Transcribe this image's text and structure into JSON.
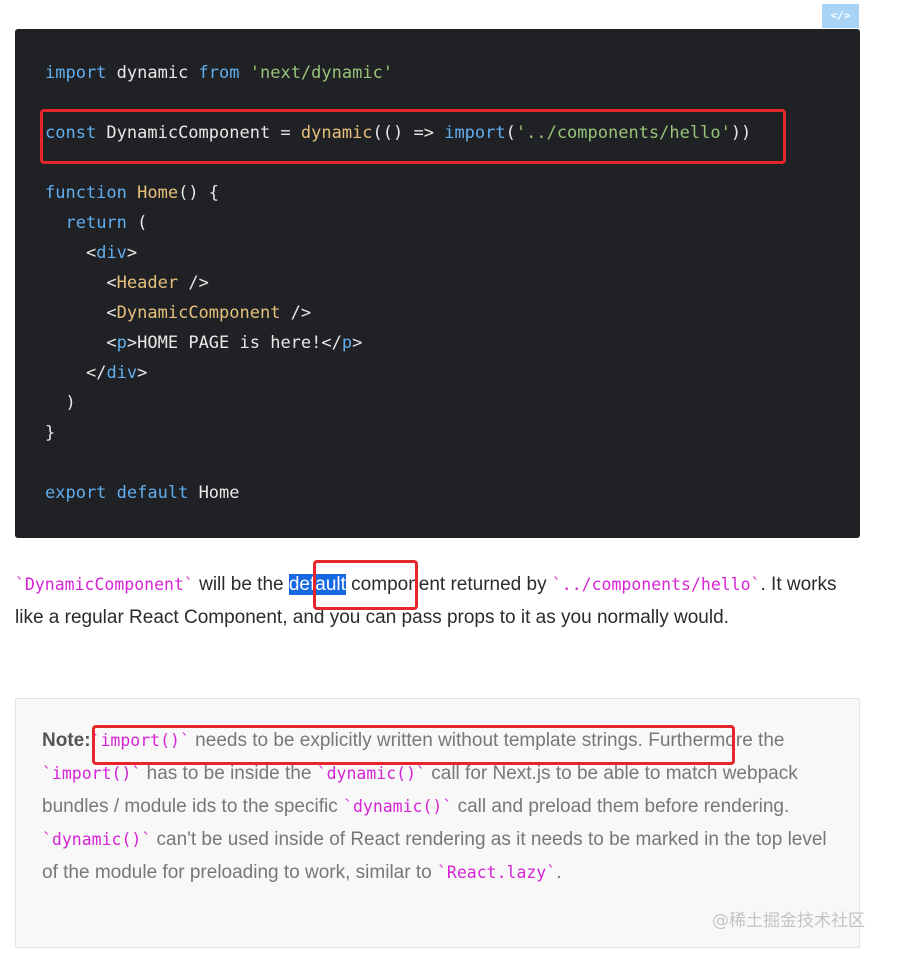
{
  "badge": {
    "label": "</>"
  },
  "code": {
    "line1": {
      "k1": "import",
      "t1": " dynamic ",
      "k2": "from",
      "sp": " ",
      "s1": "'next/dynamic'"
    },
    "line2": {
      "k1": "const",
      "t1": " DynamicComponent = ",
      "f1": "dynamic",
      "t2": "(() => ",
      "k2": "import",
      "t3": "(",
      "s1": "'../components/hello'",
      "t4": "))"
    },
    "line3": {
      "k1": "function",
      "sp": " ",
      "f1": "Home",
      "t1": "() {"
    },
    "line4": {
      "ind": "  ",
      "k1": "return",
      "t1": " ("
    },
    "line5": {
      "ind": "    ",
      "t1": "<",
      "g1": "div",
      "t2": ">"
    },
    "line6": {
      "ind": "      ",
      "t1": "<",
      "g1": "Header",
      "t2": " />"
    },
    "line7": {
      "ind": "      ",
      "t1": "<",
      "g1": "DynamicComponent",
      "t2": " />"
    },
    "line8": {
      "ind": "      ",
      "t1": "<",
      "g1": "p",
      "t2": ">HOME PAGE is here!</",
      "g2": "p",
      "t3": ">"
    },
    "line9": {
      "ind": "    ",
      "t1": "</",
      "g1": "div",
      "t2": ">"
    },
    "line10": {
      "ind": "  ",
      "t1": ")"
    },
    "line11": {
      "t1": "}"
    },
    "line12": {
      "k1": "export",
      "sp": " ",
      "k2": "default",
      "t1": " Home"
    }
  },
  "paragraph": {
    "code1": "`DynamicComponent`",
    "t1": " will be the ",
    "selected": "default",
    "t2": " component returned by ",
    "code2": "`../components/hello`",
    "t3": ". It works like a regular React Component, and you can pass props to it as you normally would."
  },
  "note": {
    "label": "Note:",
    "c1": "`import()`",
    "t1": " needs to be explicitly written without template strings. Furthermore the ",
    "c2": "`import()`",
    "t2": " has to be inside the ",
    "c3": "`dynamic()`",
    "t3": " call for Next.js to be able to match webpack bundles / module ids to the specific ",
    "c4": "`dynamic()`",
    "t4": " call and preload them before rendering. ",
    "c5": "`dynamic()`",
    "t5": " can't be used inside of React rendering as it needs to be marked in the top level of the module for preloading to work, similar to ",
    "c6": "`React.lazy`",
    "t6": "."
  },
  "watermark": "@稀土掘金技术社区",
  "colors": {
    "highlight_box": "#e5262a",
    "selection": "#1668e3",
    "inline_code": "#d424d4",
    "code_bg": "#1f2124"
  }
}
